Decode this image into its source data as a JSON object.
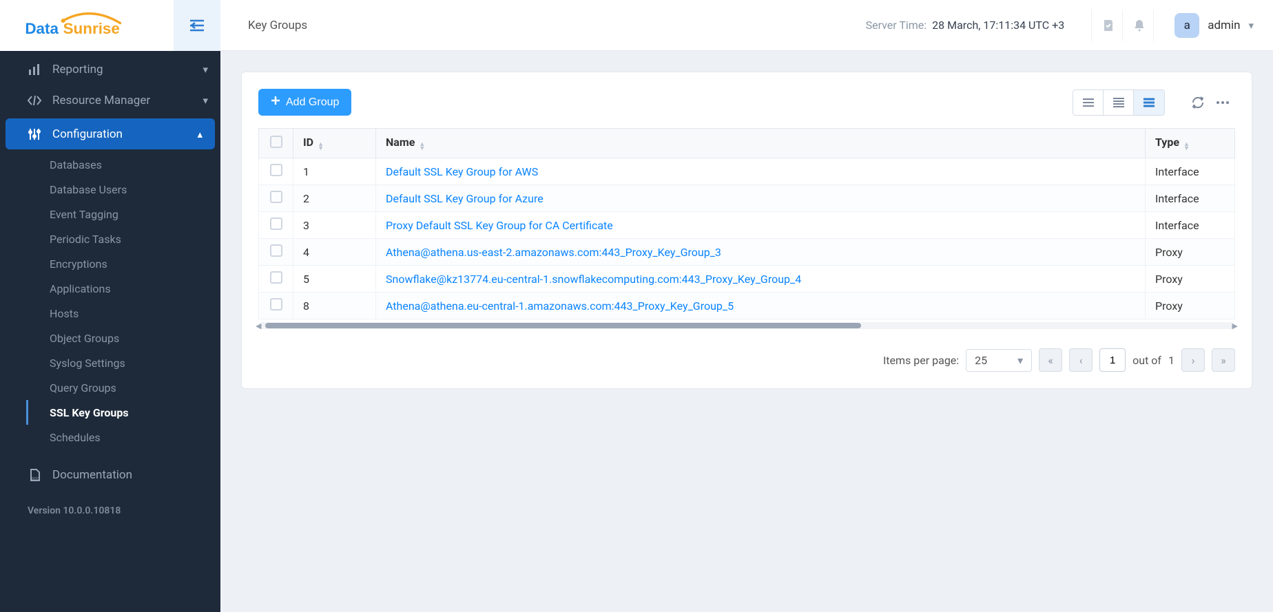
{
  "logo": {
    "text_left": "Data",
    "text_right": "Sunrise"
  },
  "header": {
    "page_title": "Key Groups",
    "server_time_label": "Server Time:",
    "server_time_value": "28 March, 17:11:34  UTC +3",
    "user_initial": "a",
    "user_name": "admin"
  },
  "sidebar": {
    "items": [
      {
        "label": "Reporting"
      },
      {
        "label": "Resource Manager"
      },
      {
        "label": "Configuration"
      }
    ],
    "sub_items": [
      {
        "label": "Databases"
      },
      {
        "label": "Database Users"
      },
      {
        "label": "Event Tagging"
      },
      {
        "label": "Periodic Tasks"
      },
      {
        "label": "Encryptions"
      },
      {
        "label": "Applications"
      },
      {
        "label": "Hosts"
      },
      {
        "label": "Object Groups"
      },
      {
        "label": "Syslog Settings"
      },
      {
        "label": "Query Groups"
      },
      {
        "label": "SSL Key Groups"
      },
      {
        "label": "Schedules"
      }
    ],
    "documentation_label": "Documentation",
    "version_label": "Version 10.0.0.10818"
  },
  "toolbar": {
    "add_button_label": "Add Group"
  },
  "table": {
    "columns": {
      "id": "ID",
      "name": "Name",
      "type": "Type"
    },
    "rows": [
      {
        "id": "1",
        "name": "Default SSL Key Group for AWS",
        "type": "Interface"
      },
      {
        "id": "2",
        "name": "Default SSL Key Group for Azure",
        "type": "Interface"
      },
      {
        "id": "3",
        "name": "Proxy Default SSL Key Group for CA Certificate",
        "type": "Interface"
      },
      {
        "id": "4",
        "name": "Athena@athena.us-east-2.amazonaws.com:443_Proxy_Key_Group_3",
        "type": "Proxy"
      },
      {
        "id": "5",
        "name": "Snowflake@kz13774.eu-central-1.snowflakecomputing.com:443_Proxy_Key_Group_4",
        "type": "Proxy"
      },
      {
        "id": "8",
        "name": "Athena@athena.eu-central-1.amazonaws.com:443_Proxy_Key_Group_5",
        "type": "Proxy"
      }
    ]
  },
  "pagination": {
    "items_per_page_label": "Items per page:",
    "items_per_page_value": "25",
    "current_page": "1",
    "out_of_label": "out of",
    "total_pages": "1"
  }
}
